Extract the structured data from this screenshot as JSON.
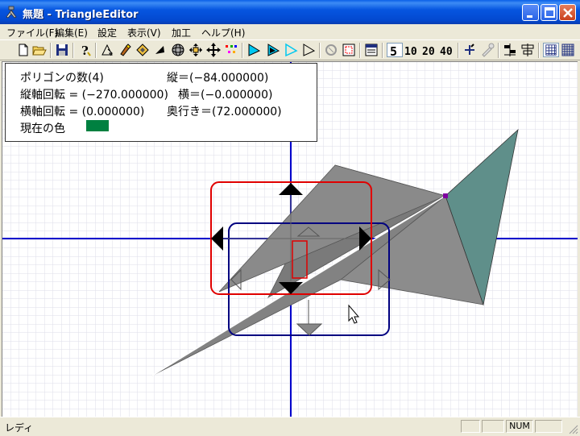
{
  "window": {
    "title": "無題 - TriangleEditor"
  },
  "menu": {
    "items": [
      "ファイル(F)",
      "編集(E)",
      "設定",
      "表示(V)",
      "加工",
      "ヘルプ(H)"
    ]
  },
  "toolbar": {
    "icons": [
      "new-icon",
      "open-icon",
      "save-icon",
      "help-icon",
      "select-icon",
      "paint-icon",
      "move-icon",
      "fill-icon",
      "sphere-icon",
      "scale-icon",
      "translate-icon",
      "color-points-icon",
      "triangle-solid-icon",
      "triangle-outline-blue-icon",
      "triangle-light-icon",
      "triangle-outline-icon",
      "lasso-icon",
      "grid-select-icon",
      "panel-icon",
      "five-icon",
      "ten-icon",
      "twenty-icon",
      "forty-icon",
      "pin-icon",
      "eyedropper-icon",
      "align-left-icon",
      "align-right-icon",
      "grid-icon",
      "grid-fine-icon"
    ],
    "labels": {
      "five": "5",
      "ten": "10",
      "twenty": "20",
      "forty": "40"
    }
  },
  "info": {
    "polygon_count": "ポリゴンの数(4)",
    "vertical": "縦＝(−84.000000)",
    "vertical_rotation": "縦軸回転 = (−270.000000)",
    "horizontal": "横＝(−0.000000)",
    "horizontal_rotation": "横軸回転 = (0.000000)",
    "depth": "奥行き＝(72.000000)",
    "current_color_label": "現在の色",
    "current_color": "#008040"
  },
  "status": {
    "text": "レディ",
    "num": "NUM"
  },
  "colors": {
    "titlebar": "#0A5FE8",
    "polygon": "#808080",
    "polygon_teal": "#5F8F8A",
    "gizmo_red": "#E00000",
    "gizmo_blue": "#000080",
    "axis": "#0000CC",
    "grid": "#DCDCE6"
  }
}
